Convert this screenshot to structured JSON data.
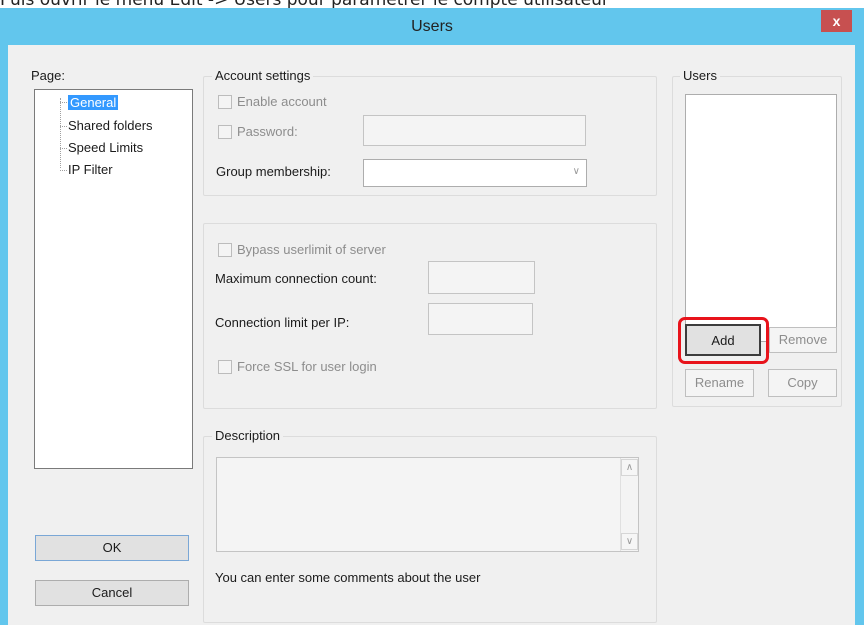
{
  "above_text": "Puis ouvrir le menu Edit -> Users pour paramétrer le compte utilisateur",
  "window": {
    "title": "Users",
    "close_glyph": "x"
  },
  "page_panel": {
    "label": "Page:",
    "items": [
      "General",
      "Shared folders",
      "Speed Limits",
      "IP Filter"
    ]
  },
  "account_settings": {
    "title": "Account settings",
    "enable_account": "Enable account",
    "password": "Password:",
    "group_membership": "Group membership:"
  },
  "limits": {
    "bypass": "Bypass userlimit of server",
    "max_conn": "Maximum connection count:",
    "conn_per_ip": "Connection limit per IP:",
    "force_ssl": "Force SSL for user login"
  },
  "description": {
    "title": "Description",
    "hint": "You can enter some comments about the user"
  },
  "users": {
    "title": "Users",
    "add": "Add",
    "remove": "Remove",
    "rename": "Rename",
    "copy": "Copy"
  },
  "buttons": {
    "ok": "OK",
    "cancel": "Cancel"
  },
  "colors": {
    "titlebar": "#62c6ed",
    "close": "#c75050",
    "selection": "#3399ff",
    "highlight": "#e8131b"
  }
}
